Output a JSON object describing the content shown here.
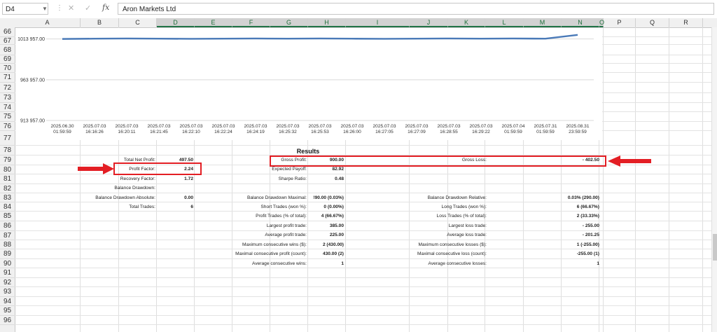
{
  "name_box": "D4",
  "formula_bar": {
    "value": "Aron Markets Ltd",
    "fx_label": "fx"
  },
  "columns": [
    "A",
    "B",
    "C",
    "D",
    "E",
    "F",
    "G",
    "H",
    "I",
    "J",
    "K",
    "L",
    "M",
    "N",
    "O",
    "P",
    "Q",
    "R"
  ],
  "rows": [
    "66",
    "67",
    "68",
    "69",
    "70",
    "71",
    "72",
    "73",
    "74",
    "75",
    "76",
    "77",
    "78",
    "79",
    "80",
    "81",
    "82",
    "83",
    "84",
    "85",
    "86",
    "87",
    "88",
    "89",
    "90",
    "91",
    "92",
    "93",
    "94",
    "95",
    "96"
  ],
  "chart_data": {
    "type": "line",
    "y_ticks": [
      "1013 957.00",
      "963 957.00",
      "913 957.00"
    ],
    "ylim": [
      913957,
      1023957
    ],
    "categories": [
      [
        "2025.06.30",
        "01:59:59"
      ],
      [
        "2025.07.03",
        "16:16:26"
      ],
      [
        "2025.07.03",
        "16:20:11"
      ],
      [
        "2025.07.03",
        "16:21:45"
      ],
      [
        "2025.07.03",
        "16:22:10"
      ],
      [
        "2025.07.03",
        "16:22:24"
      ],
      [
        "2025.07.03",
        "16:24:19"
      ],
      [
        "2025.07.03",
        "16:25:32"
      ],
      [
        "2025.07.03",
        "16:25:53"
      ],
      [
        "2025.07.03",
        "16:26:00"
      ],
      [
        "2025.07.03",
        "16:27:05"
      ],
      [
        "2025.07.03",
        "16:27:09"
      ],
      [
        "2025.07.03",
        "16:28:55"
      ],
      [
        "2025.07.03",
        "16:29:22"
      ],
      [
        "2025.07.04",
        "01:59:59"
      ],
      [
        "2025.07.31",
        "01:59:59"
      ],
      [
        "2025.08.31",
        "23:59:59"
      ]
    ],
    "values": [
      1013957,
      1014342,
      1014567,
      1014312,
      1014112,
      1014342,
      1014567,
      1014342,
      1014567,
      1014312,
      1014112,
      1014342,
      1014567,
      1014342,
      1014567,
      1014312,
      1018957
    ],
    "series_color": "#4a7ab8",
    "grid": true
  },
  "results": {
    "title": "Results",
    "left": [
      {
        "label": "Total Net Profit:",
        "value": "497.50"
      },
      {
        "label": "Profit Factor:",
        "value": "2.24"
      },
      {
        "label": "Recovery Factor:",
        "value": "1.72"
      },
      {
        "label": "Balance Drawdown:",
        "value": ""
      },
      {
        "label": "Balance Drawdown Absolute:",
        "value": "0.00"
      },
      {
        "label": "Total Trades:",
        "value": "6"
      }
    ],
    "middle": [
      {
        "label": "Gross Profit:",
        "value": "900.00"
      },
      {
        "label": "Expected Payoff:",
        "value": "82.92"
      },
      {
        "label": "Sharpe Ratio:",
        "value": "0.48"
      },
      {
        "label": "",
        "value": ""
      },
      {
        "label": "Balance Drawdown Maximal:",
        "value": "!90.00 (0.03%)"
      },
      {
        "label": "Short Trades (won %):",
        "value": "0 (0.00%)"
      },
      {
        "label": "Profit Trades (% of total):",
        "value": "4 (66.67%)"
      },
      {
        "label": "Largest profit trade:",
        "value": "385.00"
      },
      {
        "label": "Average profit trade:",
        "value": "225.00"
      },
      {
        "label": "Maximum consecutive wins ($):",
        "value": "2 (430.00)"
      },
      {
        "label": "Maximal consecutive profit (count):",
        "value": "430.00 (2)"
      },
      {
        "label": "Average consecutive wins:",
        "value": "1"
      }
    ],
    "right": [
      {
        "label": "Gross Loss:",
        "value": "- 402.50"
      },
      {
        "label": "",
        "value": ""
      },
      {
        "label": "",
        "value": ""
      },
      {
        "label": "",
        "value": ""
      },
      {
        "label": "Balance Drawdown Relative:",
        "value": "0.03% (290.00)"
      },
      {
        "label": "Long Trades (won %):",
        "value": "6 (66.67%)"
      },
      {
        "label": "Loss Trades (% of total):",
        "value": "2 (33.33%)"
      },
      {
        "label": "Largest loss trade:",
        "value": "- 255.00"
      },
      {
        "label": "Average loss trade:",
        "value": "- 201.25"
      },
      {
        "label": "Maximum consecutive losses ($):",
        "value": "1 (-255.00)"
      },
      {
        "label": "Maximal consecutive loss (count):",
        "value": "-255.00 (1)"
      },
      {
        "label": "Average consecutive losses:",
        "value": "1"
      }
    ]
  },
  "colors": {
    "highlight": "#e31e24",
    "selected_header": "#217346"
  }
}
